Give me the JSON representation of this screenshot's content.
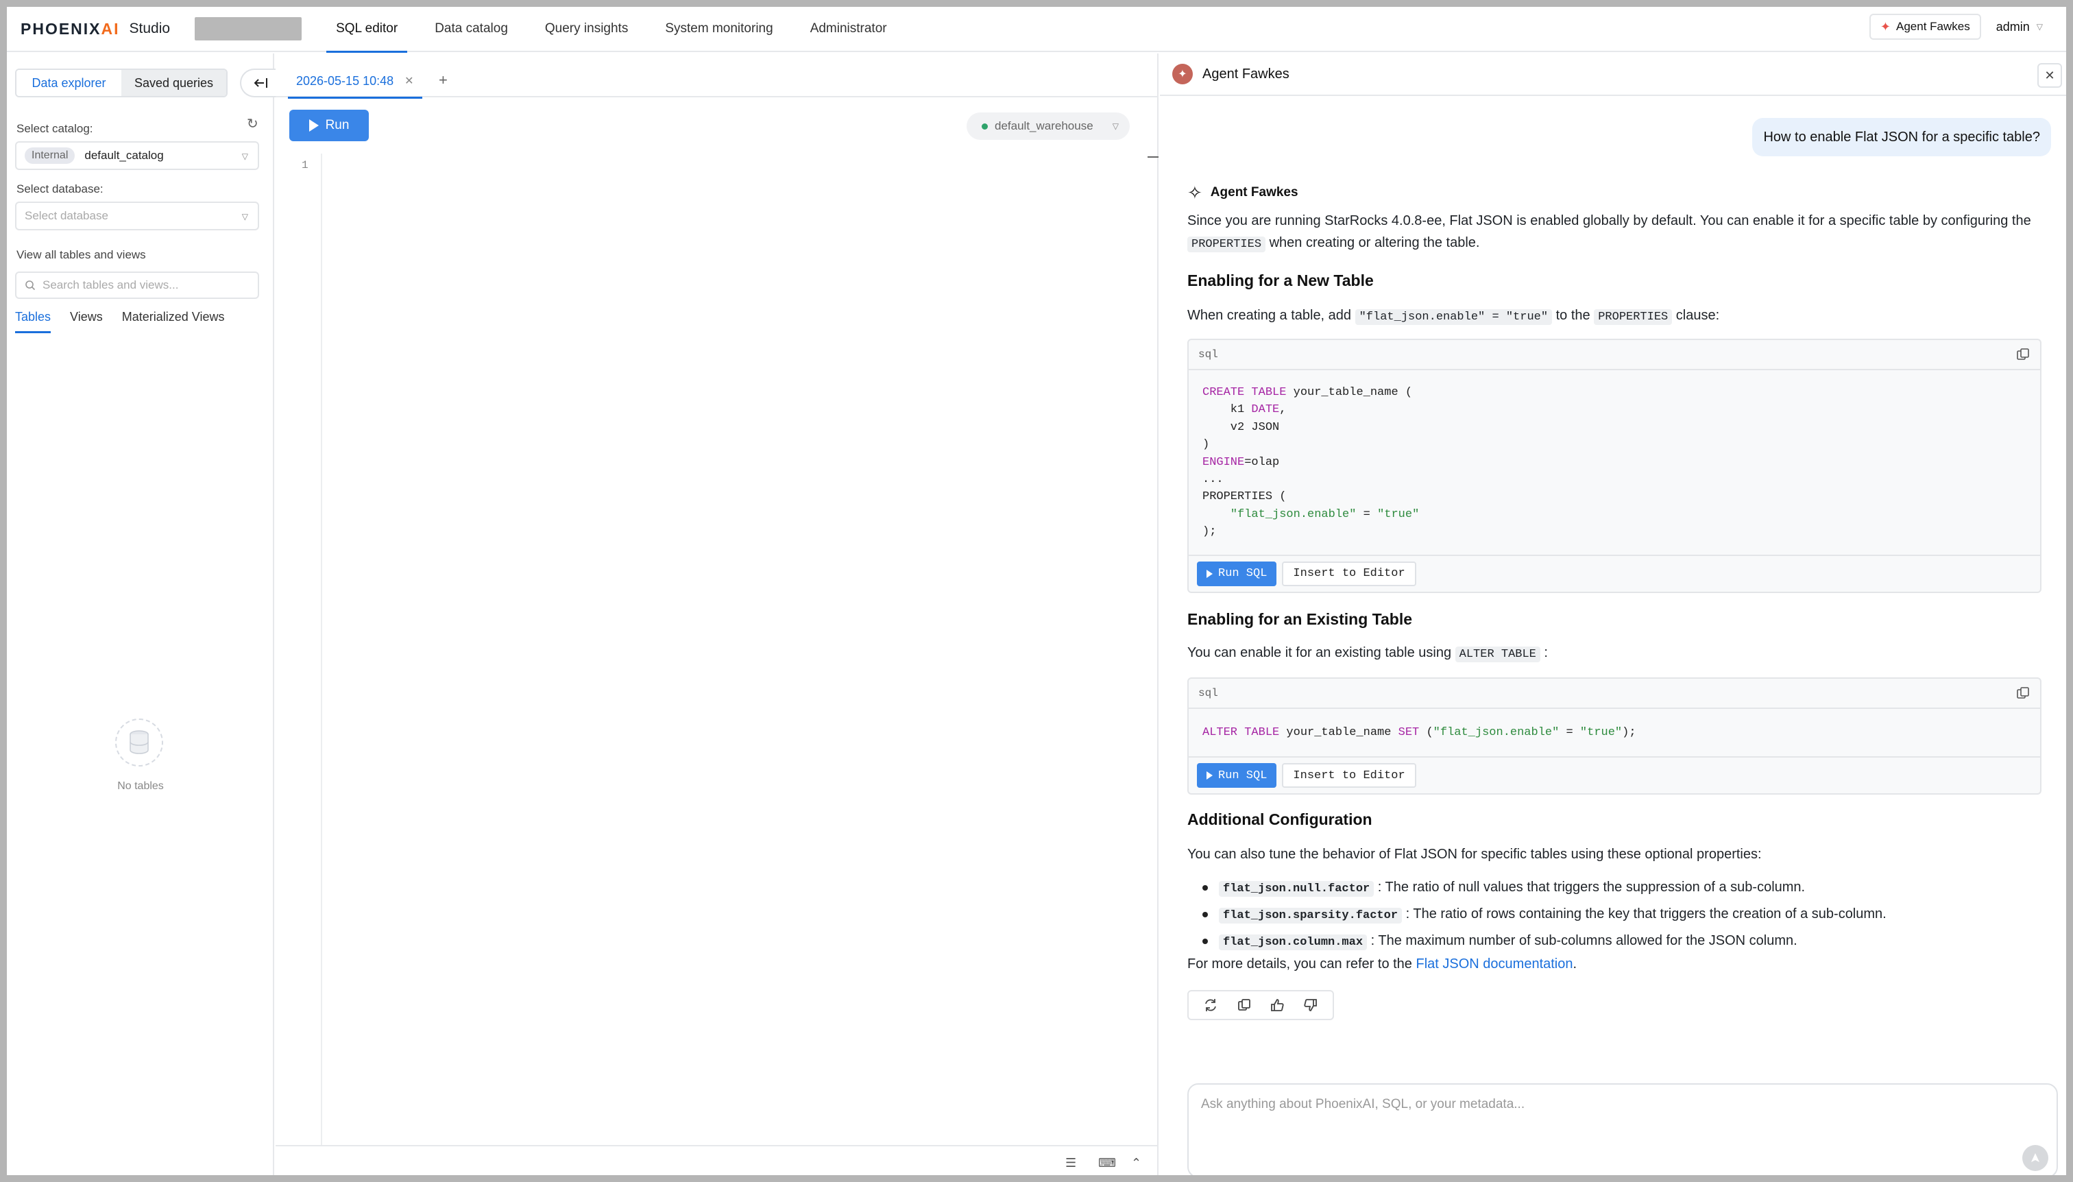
{
  "brand": {
    "logo_main": "PHOENIX",
    "logo_accent": "AI",
    "studio": "Studio"
  },
  "nav": [
    {
      "label": "SQL editor",
      "active": true
    },
    {
      "label": "Data catalog",
      "active": false
    },
    {
      "label": "Query insights",
      "active": false
    },
    {
      "label": "System monitoring",
      "active": false
    },
    {
      "label": "Administrator",
      "active": false
    }
  ],
  "topright": {
    "agent_button": "Agent Fawkes",
    "user": "admin"
  },
  "sidebar": {
    "segments": [
      "Data explorer",
      "Saved queries"
    ],
    "catalog_label": "Select catalog:",
    "catalog_badge": "Internal",
    "catalog_value": "default_catalog",
    "database_label": "Select database:",
    "database_placeholder": "Select database",
    "view_all_label": "View all tables and views",
    "search_placeholder": "Search tables and views...",
    "tabs": [
      "Tables",
      "Views",
      "Materialized Views"
    ],
    "empty_text": "No tables"
  },
  "editor": {
    "tab_label": "2026-05-15 10:48",
    "run_label": "Run",
    "warehouse": "default_warehouse",
    "line_number": "1"
  },
  "agent": {
    "title": "Agent Fawkes",
    "user_message": "How to enable Flat JSON for a specific table?",
    "reply_author": "Agent Fawkes",
    "intro_1": "Since you are running StarRocks 4.0.8-ee, Flat JSON is enabled globally by default. You can enable it for a specific table by configuring the ",
    "intro_code": "PROPERTIES",
    "intro_2": " when creating or altering the table.",
    "section1_title": "Enabling for a New Table",
    "section1_p1": "When creating a table, add ",
    "section1_code1": "\"flat_json.enable\" = \"true\"",
    "section1_p2": " to the ",
    "section1_code2": "PROPERTIES",
    "section1_p3": " clause:",
    "code_lang": "sql",
    "run_sql_label": "Run SQL",
    "insert_label": "Insert to Editor",
    "section2_title": "Enabling for an Existing Table",
    "section2_p1": "You can enable it for an existing table using ",
    "section2_code": "ALTER TABLE",
    "section2_p2": " :",
    "section3_title": "Additional Configuration",
    "section3_p": "You can also tune the behavior of Flat JSON for specific tables using these optional properties:",
    "bullets": [
      {
        "code": "flat_json.null.factor",
        "text": " : The ratio of null values that triggers the suppression of a sub-column."
      },
      {
        "code": "flat_json.sparsity.factor",
        "text": " : The ratio of rows containing the key that triggers the creation of a sub-column."
      },
      {
        "code": "flat_json.column.max",
        "text": " : The maximum number of sub-columns allowed for the JSON column."
      }
    ],
    "footer_p1": "For more details, you can refer to the ",
    "footer_link": "Flat JSON documentation",
    "footer_p2": ".",
    "input_placeholder": "Ask anything about PhoenixAI, SQL, or your metadata..."
  },
  "colors": {
    "accent": "#1a6fdc",
    "run_button": "#3a86e8",
    "logo_accent": "#f26b1d",
    "user_bubble": "#e8f1fc"
  }
}
